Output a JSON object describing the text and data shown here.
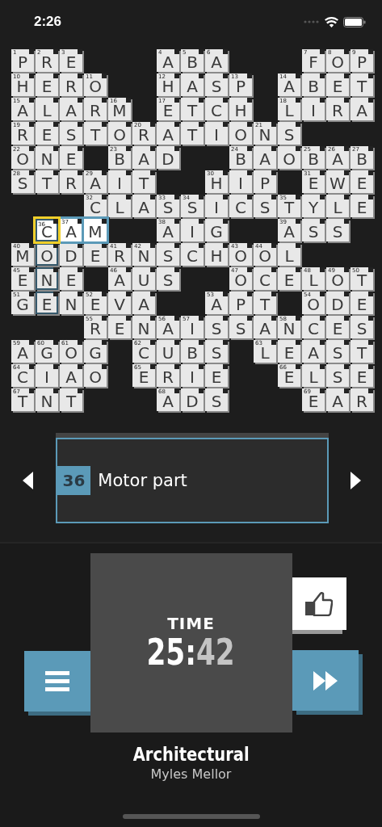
{
  "status_bar": {
    "time": "2:26"
  },
  "grid": [
    {
      "cells": [
        {
          "kind": "letter",
          "letter": "P",
          "number": "1",
          "selected": false,
          "in_word": false,
          "in_cross": false
        },
        {
          "kind": "letter",
          "letter": "R",
          "number": "2",
          "selected": false,
          "in_word": false,
          "in_cross": false
        },
        {
          "kind": "letter",
          "letter": "E",
          "number": "3",
          "selected": false,
          "in_word": false,
          "in_cross": false
        },
        {
          "kind": "block"
        },
        {
          "kind": "block"
        },
        {
          "kind": "block"
        },
        {
          "kind": "letter",
          "letter": "A",
          "number": "4",
          "selected": false,
          "in_word": false,
          "in_cross": false
        },
        {
          "kind": "letter",
          "letter": "B",
          "number": "5",
          "selected": false,
          "in_word": false,
          "in_cross": false
        },
        {
          "kind": "letter",
          "letter": "A",
          "number": "6",
          "selected": false,
          "in_word": false,
          "in_cross": false
        },
        {
          "kind": "block"
        },
        {
          "kind": "block"
        },
        {
          "kind": "block"
        },
        {
          "kind": "letter",
          "letter": "F",
          "number": "7",
          "selected": false,
          "in_word": false,
          "in_cross": false
        },
        {
          "kind": "letter",
          "letter": "O",
          "number": "8",
          "selected": false,
          "in_word": false,
          "in_cross": false
        },
        {
          "kind": "letter",
          "letter": "P",
          "number": "9",
          "selected": false,
          "in_word": false,
          "in_cross": false
        }
      ]
    },
    {
      "cells": [
        {
          "kind": "letter",
          "letter": "H",
          "number": "10",
          "selected": false,
          "in_word": false,
          "in_cross": false
        },
        {
          "kind": "letter",
          "letter": "E",
          "selected": false,
          "in_word": false,
          "in_cross": false
        },
        {
          "kind": "letter",
          "letter": "R",
          "selected": false,
          "in_word": false,
          "in_cross": false
        },
        {
          "kind": "letter",
          "letter": "O",
          "number": "11",
          "selected": false,
          "in_word": false,
          "in_cross": false
        },
        {
          "kind": "block"
        },
        {
          "kind": "block"
        },
        {
          "kind": "letter",
          "letter": "H",
          "number": "12",
          "selected": false,
          "in_word": false,
          "in_cross": false
        },
        {
          "kind": "letter",
          "letter": "A",
          "selected": false,
          "in_word": false,
          "in_cross": false
        },
        {
          "kind": "letter",
          "letter": "S",
          "selected": false,
          "in_word": false,
          "in_cross": false
        },
        {
          "kind": "letter",
          "letter": "P",
          "number": "13",
          "selected": false,
          "in_word": false,
          "in_cross": false
        },
        {
          "kind": "block"
        },
        {
          "kind": "letter",
          "letter": "A",
          "number": "14",
          "selected": false,
          "in_word": false,
          "in_cross": false
        },
        {
          "kind": "letter",
          "letter": "B",
          "selected": false,
          "in_word": false,
          "in_cross": false
        },
        {
          "kind": "letter",
          "letter": "E",
          "selected": false,
          "in_word": false,
          "in_cross": false
        },
        {
          "kind": "letter",
          "letter": "T",
          "selected": false,
          "in_word": false,
          "in_cross": false
        }
      ]
    },
    {
      "cells": [
        {
          "kind": "letter",
          "letter": "A",
          "number": "15",
          "selected": false,
          "in_word": false,
          "in_cross": false
        },
        {
          "kind": "letter",
          "letter": "L",
          "selected": false,
          "in_word": false,
          "in_cross": false
        },
        {
          "kind": "letter",
          "letter": "A",
          "selected": false,
          "in_word": false,
          "in_cross": false
        },
        {
          "kind": "letter",
          "letter": "R",
          "selected": false,
          "in_word": false,
          "in_cross": false
        },
        {
          "kind": "letter",
          "letter": "M",
          "number": "16",
          "selected": false,
          "in_word": false,
          "in_cross": false
        },
        {
          "kind": "block"
        },
        {
          "kind": "letter",
          "letter": "E",
          "number": "17",
          "selected": false,
          "in_word": false,
          "in_cross": false
        },
        {
          "kind": "letter",
          "letter": "T",
          "selected": false,
          "in_word": false,
          "in_cross": false
        },
        {
          "kind": "letter",
          "letter": "C",
          "selected": false,
          "in_word": false,
          "in_cross": false
        },
        {
          "kind": "letter",
          "letter": "H",
          "selected": false,
          "in_word": false,
          "in_cross": false
        },
        {
          "kind": "block"
        },
        {
          "kind": "letter",
          "letter": "L",
          "number": "18",
          "selected": false,
          "in_word": false,
          "in_cross": false
        },
        {
          "kind": "letter",
          "letter": "I",
          "selected": false,
          "in_word": false,
          "in_cross": false
        },
        {
          "kind": "letter",
          "letter": "R",
          "selected": false,
          "in_word": false,
          "in_cross": false
        },
        {
          "kind": "letter",
          "letter": "A",
          "selected": false,
          "in_word": false,
          "in_cross": false
        }
      ]
    },
    {
      "cells": [
        {
          "kind": "letter",
          "letter": "R",
          "number": "19",
          "selected": false,
          "in_word": false,
          "in_cross": false
        },
        {
          "kind": "letter",
          "letter": "E",
          "selected": false,
          "in_word": false,
          "in_cross": false
        },
        {
          "kind": "letter",
          "letter": "S",
          "selected": false,
          "in_word": false,
          "in_cross": false
        },
        {
          "kind": "letter",
          "letter": "T",
          "selected": false,
          "in_word": false,
          "in_cross": false
        },
        {
          "kind": "letter",
          "letter": "O",
          "selected": false,
          "in_word": false,
          "in_cross": false
        },
        {
          "kind": "letter",
          "letter": "R",
          "number": "20",
          "selected": false,
          "in_word": false,
          "in_cross": false
        },
        {
          "kind": "letter",
          "letter": "A",
          "selected": false,
          "in_word": false,
          "in_cross": false
        },
        {
          "kind": "letter",
          "letter": "T",
          "selected": false,
          "in_word": false,
          "in_cross": false
        },
        {
          "kind": "letter",
          "letter": "I",
          "selected": false,
          "in_word": false,
          "in_cross": false
        },
        {
          "kind": "letter",
          "letter": "O",
          "selected": false,
          "in_word": false,
          "in_cross": false
        },
        {
          "kind": "letter",
          "letter": "N",
          "number": "21",
          "selected": false,
          "in_word": false,
          "in_cross": false
        },
        {
          "kind": "letter",
          "letter": "S",
          "selected": false,
          "in_word": false,
          "in_cross": false
        },
        {
          "kind": "block"
        },
        {
          "kind": "block"
        },
        {
          "kind": "block"
        }
      ]
    },
    {
      "cells": [
        {
          "kind": "letter",
          "letter": "O",
          "number": "22",
          "selected": false,
          "in_word": false,
          "in_cross": false
        },
        {
          "kind": "letter",
          "letter": "N",
          "selected": false,
          "in_word": false,
          "in_cross": false
        },
        {
          "kind": "letter",
          "letter": "E",
          "selected": false,
          "in_word": false,
          "in_cross": false
        },
        {
          "kind": "block"
        },
        {
          "kind": "letter",
          "letter": "B",
          "number": "23",
          "selected": false,
          "in_word": false,
          "in_cross": false
        },
        {
          "kind": "letter",
          "letter": "A",
          "selected": false,
          "in_word": false,
          "in_cross": false
        },
        {
          "kind": "letter",
          "letter": "D",
          "selected": false,
          "in_word": false,
          "in_cross": false
        },
        {
          "kind": "block"
        },
        {
          "kind": "block"
        },
        {
          "kind": "letter",
          "letter": "B",
          "number": "24",
          "selected": false,
          "in_word": false,
          "in_cross": false
        },
        {
          "kind": "letter",
          "letter": "A",
          "selected": false,
          "in_word": false,
          "in_cross": false
        },
        {
          "kind": "letter",
          "letter": "O",
          "selected": false,
          "in_word": false,
          "in_cross": false
        },
        {
          "kind": "letter",
          "letter": "B",
          "number": "25",
          "selected": false,
          "in_word": false,
          "in_cross": false
        },
        {
          "kind": "letter",
          "letter": "A",
          "number": "26",
          "selected": false,
          "in_word": false,
          "in_cross": false
        },
        {
          "kind": "letter",
          "letter": "B",
          "number": "27",
          "selected": false,
          "in_word": false,
          "in_cross": false
        }
      ]
    },
    {
      "cells": [
        {
          "kind": "letter",
          "letter": "S",
          "number": "28",
          "selected": false,
          "in_word": false,
          "in_cross": false
        },
        {
          "kind": "letter",
          "letter": "T",
          "selected": false,
          "in_word": false,
          "in_cross": false
        },
        {
          "kind": "letter",
          "letter": "R",
          "selected": false,
          "in_word": false,
          "in_cross": false
        },
        {
          "kind": "letter",
          "letter": "A",
          "number": "29",
          "selected": false,
          "in_word": false,
          "in_cross": false
        },
        {
          "kind": "letter",
          "letter": "I",
          "selected": false,
          "in_word": false,
          "in_cross": false
        },
        {
          "kind": "letter",
          "letter": "T",
          "selected": false,
          "in_word": false,
          "in_cross": false
        },
        {
          "kind": "block"
        },
        {
          "kind": "block"
        },
        {
          "kind": "letter",
          "letter": "H",
          "number": "30",
          "selected": false,
          "in_word": false,
          "in_cross": false
        },
        {
          "kind": "letter",
          "letter": "I",
          "selected": false,
          "in_word": false,
          "in_cross": false
        },
        {
          "kind": "letter",
          "letter": "P",
          "selected": false,
          "in_word": false,
          "in_cross": false
        },
        {
          "kind": "block"
        },
        {
          "kind": "letter",
          "letter": "E",
          "number": "31",
          "selected": false,
          "in_word": false,
          "in_cross": false
        },
        {
          "kind": "letter",
          "letter": "W",
          "selected": false,
          "in_word": false,
          "in_cross": false
        },
        {
          "kind": "letter",
          "letter": "E",
          "selected": false,
          "in_word": false,
          "in_cross": false
        }
      ]
    },
    {
      "cells": [
        {
          "kind": "block"
        },
        {
          "kind": "block"
        },
        {
          "kind": "block"
        },
        {
          "kind": "letter",
          "letter": "C",
          "number": "32",
          "selected": false,
          "in_word": false,
          "in_cross": false
        },
        {
          "kind": "letter",
          "letter": "L",
          "selected": false,
          "in_word": false,
          "in_cross": false
        },
        {
          "kind": "letter",
          "letter": "A",
          "selected": false,
          "in_word": false,
          "in_cross": false
        },
        {
          "kind": "letter",
          "letter": "S",
          "number": "33",
          "selected": false,
          "in_word": false,
          "in_cross": false
        },
        {
          "kind": "letter",
          "letter": "S",
          "number": "34",
          "selected": false,
          "in_word": false,
          "in_cross": false
        },
        {
          "kind": "letter",
          "letter": "I",
          "selected": false,
          "in_word": false,
          "in_cross": false
        },
        {
          "kind": "letter",
          "letter": "C",
          "selected": false,
          "in_word": false,
          "in_cross": false
        },
        {
          "kind": "letter",
          "letter": "S",
          "selected": false,
          "in_word": false,
          "in_cross": false
        },
        {
          "kind": "letter",
          "letter": "T",
          "number": "35",
          "selected": false,
          "in_word": false,
          "in_cross": false
        },
        {
          "kind": "letter",
          "letter": "Y",
          "selected": false,
          "in_word": false,
          "in_cross": false
        },
        {
          "kind": "letter",
          "letter": "L",
          "selected": false,
          "in_word": false,
          "in_cross": false
        },
        {
          "kind": "letter",
          "letter": "E",
          "selected": false,
          "in_word": false,
          "in_cross": false
        }
      ]
    },
    {
      "cells": [
        {
          "kind": "block"
        },
        {
          "kind": "letter",
          "letter": "C",
          "number": "36",
          "selected": true,
          "in_word": true,
          "in_cross": true
        },
        {
          "kind": "letter",
          "letter": "A",
          "number": "37",
          "selected": false,
          "in_word": true,
          "in_cross": false
        },
        {
          "kind": "letter",
          "letter": "M",
          "selected": false,
          "in_word": true,
          "in_cross": false
        },
        {
          "kind": "block"
        },
        {
          "kind": "block"
        },
        {
          "kind": "letter",
          "letter": "A",
          "number": "38",
          "selected": false,
          "in_word": false,
          "in_cross": false
        },
        {
          "kind": "letter",
          "letter": "I",
          "selected": false,
          "in_word": false,
          "in_cross": false
        },
        {
          "kind": "letter",
          "letter": "G",
          "selected": false,
          "in_word": false,
          "in_cross": false
        },
        {
          "kind": "block"
        },
        {
          "kind": "block"
        },
        {
          "kind": "letter",
          "letter": "A",
          "number": "39",
          "selected": false,
          "in_word": false,
          "in_cross": false
        },
        {
          "kind": "letter",
          "letter": "S",
          "selected": false,
          "in_word": false,
          "in_cross": false
        },
        {
          "kind": "letter",
          "letter": "S",
          "selected": false,
          "in_word": false,
          "in_cross": false
        },
        {
          "kind": "block"
        }
      ]
    },
    {
      "cells": [
        {
          "kind": "letter",
          "letter": "M",
          "number": "40",
          "selected": false,
          "in_word": false,
          "in_cross": false
        },
        {
          "kind": "letter",
          "letter": "O",
          "selected": false,
          "in_word": false,
          "in_cross": true
        },
        {
          "kind": "letter",
          "letter": "D",
          "selected": false,
          "in_word": false,
          "in_cross": false
        },
        {
          "kind": "letter",
          "letter": "E",
          "selected": false,
          "in_word": false,
          "in_cross": false
        },
        {
          "kind": "letter",
          "letter": "R",
          "number": "41",
          "selected": false,
          "in_word": false,
          "in_cross": false
        },
        {
          "kind": "letter",
          "letter": "N",
          "number": "42",
          "selected": false,
          "in_word": false,
          "in_cross": false
        },
        {
          "kind": "letter",
          "letter": "S",
          "selected": false,
          "in_word": false,
          "in_cross": false
        },
        {
          "kind": "letter",
          "letter": "C",
          "selected": false,
          "in_word": false,
          "in_cross": false
        },
        {
          "kind": "letter",
          "letter": "H",
          "selected": false,
          "in_word": false,
          "in_cross": false
        },
        {
          "kind": "letter",
          "letter": "O",
          "number": "43",
          "selected": false,
          "in_word": false,
          "in_cross": false
        },
        {
          "kind": "letter",
          "letter": "O",
          "number": "44",
          "selected": false,
          "in_word": false,
          "in_cross": false
        },
        {
          "kind": "letter",
          "letter": "L",
          "selected": false,
          "in_word": false,
          "in_cross": false
        },
        {
          "kind": "block"
        },
        {
          "kind": "block"
        },
        {
          "kind": "block"
        }
      ]
    },
    {
      "cells": [
        {
          "kind": "letter",
          "letter": "E",
          "number": "45",
          "selected": false,
          "in_word": false,
          "in_cross": false
        },
        {
          "kind": "letter",
          "letter": "N",
          "selected": false,
          "in_word": false,
          "in_cross": true
        },
        {
          "kind": "letter",
          "letter": "E",
          "selected": false,
          "in_word": false,
          "in_cross": false
        },
        {
          "kind": "block"
        },
        {
          "kind": "letter",
          "letter": "A",
          "number": "46",
          "selected": false,
          "in_word": false,
          "in_cross": false
        },
        {
          "kind": "letter",
          "letter": "U",
          "selected": false,
          "in_word": false,
          "in_cross": false
        },
        {
          "kind": "letter",
          "letter": "S",
          "selected": false,
          "in_word": false,
          "in_cross": false
        },
        {
          "kind": "block"
        },
        {
          "kind": "block"
        },
        {
          "kind": "letter",
          "letter": "O",
          "number": "47",
          "selected": false,
          "in_word": false,
          "in_cross": false
        },
        {
          "kind": "letter",
          "letter": "C",
          "selected": false,
          "in_word": false,
          "in_cross": false
        },
        {
          "kind": "letter",
          "letter": "E",
          "selected": false,
          "in_word": false,
          "in_cross": false
        },
        {
          "kind": "letter",
          "letter": "L",
          "number": "48",
          "selected": false,
          "in_word": false,
          "in_cross": false
        },
        {
          "kind": "letter",
          "letter": "O",
          "number": "49",
          "selected": false,
          "in_word": false,
          "in_cross": false
        },
        {
          "kind": "letter",
          "letter": "T",
          "number": "50",
          "selected": false,
          "in_word": false,
          "in_cross": false
        }
      ]
    },
    {
      "cells": [
        {
          "kind": "letter",
          "letter": "G",
          "number": "51",
          "selected": false,
          "in_word": false,
          "in_cross": false
        },
        {
          "kind": "letter",
          "letter": "E",
          "selected": false,
          "in_word": false,
          "in_cross": true
        },
        {
          "kind": "letter",
          "letter": "N",
          "selected": false,
          "in_word": false,
          "in_cross": false
        },
        {
          "kind": "letter",
          "letter": "E",
          "number": "52",
          "selected": false,
          "in_word": false,
          "in_cross": false
        },
        {
          "kind": "letter",
          "letter": "V",
          "selected": false,
          "in_word": false,
          "in_cross": false
        },
        {
          "kind": "letter",
          "letter": "A",
          "selected": false,
          "in_word": false,
          "in_cross": false
        },
        {
          "kind": "block"
        },
        {
          "kind": "block"
        },
        {
          "kind": "letter",
          "letter": "A",
          "number": "53",
          "selected": false,
          "in_word": false,
          "in_cross": false
        },
        {
          "kind": "letter",
          "letter": "P",
          "selected": false,
          "in_word": false,
          "in_cross": false
        },
        {
          "kind": "letter",
          "letter": "T",
          "selected": false,
          "in_word": false,
          "in_cross": false
        },
        {
          "kind": "block"
        },
        {
          "kind": "letter",
          "letter": "O",
          "number": "54",
          "selected": false,
          "in_word": false,
          "in_cross": false
        },
        {
          "kind": "letter",
          "letter": "D",
          "selected": false,
          "in_word": false,
          "in_cross": false
        },
        {
          "kind": "letter",
          "letter": "E",
          "selected": false,
          "in_word": false,
          "in_cross": false
        }
      ]
    },
    {
      "cells": [
        {
          "kind": "block"
        },
        {
          "kind": "block"
        },
        {
          "kind": "block"
        },
        {
          "kind": "letter",
          "letter": "R",
          "number": "55",
          "selected": false,
          "in_word": false,
          "in_cross": false
        },
        {
          "kind": "letter",
          "letter": "E",
          "selected": false,
          "in_word": false,
          "in_cross": false
        },
        {
          "kind": "letter",
          "letter": "N",
          "selected": false,
          "in_word": false,
          "in_cross": false
        },
        {
          "kind": "letter",
          "letter": "A",
          "number": "56",
          "selected": false,
          "in_word": false,
          "in_cross": false
        },
        {
          "kind": "letter",
          "letter": "I",
          "number": "57",
          "selected": false,
          "in_word": false,
          "in_cross": false
        },
        {
          "kind": "letter",
          "letter": "S",
          "selected": false,
          "in_word": false,
          "in_cross": false
        },
        {
          "kind": "letter",
          "letter": "S",
          "selected": false,
          "in_word": false,
          "in_cross": false
        },
        {
          "kind": "letter",
          "letter": "A",
          "selected": false,
          "in_word": false,
          "in_cross": false
        },
        {
          "kind": "letter",
          "letter": "N",
          "number": "58",
          "selected": false,
          "in_word": false,
          "in_cross": false
        },
        {
          "kind": "letter",
          "letter": "C",
          "selected": false,
          "in_word": false,
          "in_cross": false
        },
        {
          "kind": "letter",
          "letter": "E",
          "selected": false,
          "in_word": false,
          "in_cross": false
        },
        {
          "kind": "letter",
          "letter": "S",
          "selected": false,
          "in_word": false,
          "in_cross": false
        }
      ]
    },
    {
      "cells": [
        {
          "kind": "letter",
          "letter": "A",
          "number": "59",
          "selected": false,
          "in_word": false,
          "in_cross": false
        },
        {
          "kind": "letter",
          "letter": "G",
          "number": "60",
          "selected": false,
          "in_word": false,
          "in_cross": false
        },
        {
          "kind": "letter",
          "letter": "O",
          "number": "61",
          "selected": false,
          "in_word": false,
          "in_cross": false
        },
        {
          "kind": "letter",
          "letter": "G",
          "selected": false,
          "in_word": false,
          "in_cross": false
        },
        {
          "kind": "block"
        },
        {
          "kind": "letter",
          "letter": "C",
          "number": "62",
          "selected": false,
          "in_word": false,
          "in_cross": false
        },
        {
          "kind": "letter",
          "letter": "U",
          "selected": false,
          "in_word": false,
          "in_cross": false
        },
        {
          "kind": "letter",
          "letter": "B",
          "selected": false,
          "in_word": false,
          "in_cross": false
        },
        {
          "kind": "letter",
          "letter": "S",
          "selected": false,
          "in_word": false,
          "in_cross": false
        },
        {
          "kind": "block"
        },
        {
          "kind": "letter",
          "letter": "L",
          "number": "63",
          "selected": false,
          "in_word": false,
          "in_cross": false
        },
        {
          "kind": "letter",
          "letter": "E",
          "selected": false,
          "in_word": false,
          "in_cross": false
        },
        {
          "kind": "letter",
          "letter": "A",
          "selected": false,
          "in_word": false,
          "in_cross": false
        },
        {
          "kind": "letter",
          "letter": "S",
          "selected": false,
          "in_word": false,
          "in_cross": false
        },
        {
          "kind": "letter",
          "letter": "T",
          "selected": false,
          "in_word": false,
          "in_cross": false
        }
      ]
    },
    {
      "cells": [
        {
          "kind": "letter",
          "letter": "C",
          "number": "64",
          "selected": false,
          "in_word": false,
          "in_cross": false
        },
        {
          "kind": "letter",
          "letter": "I",
          "selected": false,
          "in_word": false,
          "in_cross": false
        },
        {
          "kind": "letter",
          "letter": "A",
          "selected": false,
          "in_word": false,
          "in_cross": false
        },
        {
          "kind": "letter",
          "letter": "O",
          "selected": false,
          "in_word": false,
          "in_cross": false
        },
        {
          "kind": "block"
        },
        {
          "kind": "letter",
          "letter": "E",
          "number": "65",
          "selected": false,
          "in_word": false,
          "in_cross": false
        },
        {
          "kind": "letter",
          "letter": "R",
          "selected": false,
          "in_word": false,
          "in_cross": false
        },
        {
          "kind": "letter",
          "letter": "I",
          "selected": false,
          "in_word": false,
          "in_cross": false
        },
        {
          "kind": "letter",
          "letter": "E",
          "selected": false,
          "in_word": false,
          "in_cross": false
        },
        {
          "kind": "block"
        },
        {
          "kind": "block"
        },
        {
          "kind": "letter",
          "letter": "E",
          "number": "66",
          "selected": false,
          "in_word": false,
          "in_cross": false
        },
        {
          "kind": "letter",
          "letter": "L",
          "selected": false,
          "in_word": false,
          "in_cross": false
        },
        {
          "kind": "letter",
          "letter": "S",
          "selected": false,
          "in_word": false,
          "in_cross": false
        },
        {
          "kind": "letter",
          "letter": "E",
          "selected": false,
          "in_word": false,
          "in_cross": false
        }
      ]
    },
    {
      "cells": [
        {
          "kind": "letter",
          "letter": "T",
          "number": "67",
          "selected": false,
          "in_word": false,
          "in_cross": false
        },
        {
          "kind": "letter",
          "letter": "N",
          "selected": false,
          "in_word": false,
          "in_cross": false
        },
        {
          "kind": "letter",
          "letter": "T",
          "selected": false,
          "in_word": false,
          "in_cross": false
        },
        {
          "kind": "block"
        },
        {
          "kind": "block"
        },
        {
          "kind": "block"
        },
        {
          "kind": "letter",
          "letter": "A",
          "number": "68",
          "selected": false,
          "in_word": false,
          "in_cross": false
        },
        {
          "kind": "letter",
          "letter": "D",
          "selected": false,
          "in_word": false,
          "in_cross": false
        },
        {
          "kind": "letter",
          "letter": "S",
          "selected": false,
          "in_word": false,
          "in_cross": false
        },
        {
          "kind": "block"
        },
        {
          "kind": "block"
        },
        {
          "kind": "block"
        },
        {
          "kind": "letter",
          "letter": "E",
          "number": "69",
          "selected": false,
          "in_word": false,
          "in_cross": false
        },
        {
          "kind": "letter",
          "letter": "A",
          "selected": false,
          "in_word": false,
          "in_cross": false
        },
        {
          "kind": "letter",
          "letter": "R",
          "selected": false,
          "in_word": false,
          "in_cross": false
        }
      ]
    }
  ],
  "clue": {
    "number": "36",
    "text": "Motor part"
  },
  "timer": {
    "label": "TIME",
    "value_main": "25:",
    "value_tail": "42"
  },
  "puzzle": {
    "title": "Architectural",
    "author": "Myles Mellor"
  }
}
